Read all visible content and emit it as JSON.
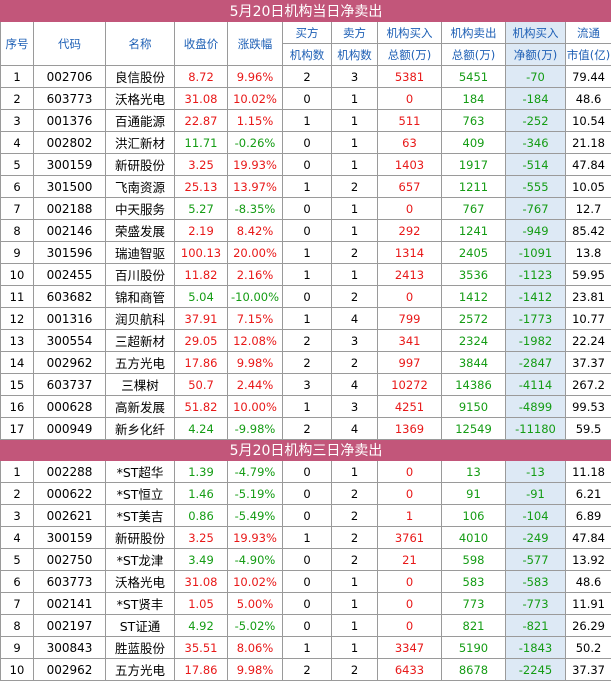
{
  "section1": {
    "title": "5月20日机构当日净卖出",
    "headers": {
      "seq": "序号",
      "code": "代码",
      "name": "名称",
      "close": "收盘价",
      "change": "涨跌幅",
      "buy_top": "买方",
      "buy_bottom": "机构数",
      "sell_top": "卖方",
      "sell_bottom": "机构数",
      "inbuy_top": "机构买入",
      "inbuy_bottom": "总额(万)",
      "insell_top": "机构卖出",
      "insell_bottom": "总额(万)",
      "net_top": "机构买入",
      "net_bottom": "净额(万)",
      "cap_top": "流通",
      "cap_bottom": "市值(亿)"
    },
    "rows": [
      [
        "1",
        "002706",
        "良信股份",
        "8.72",
        "9.96%",
        "2",
        "3",
        "5381",
        "5451",
        "-70",
        "79.44"
      ],
      [
        "2",
        "603773",
        "沃格光电",
        "31.08",
        "10.02%",
        "0",
        "1",
        "0",
        "184",
        "-184",
        "48.6"
      ],
      [
        "3",
        "001376",
        "百通能源",
        "22.87",
        "1.15%",
        "1",
        "1",
        "511",
        "763",
        "-252",
        "10.54"
      ],
      [
        "4",
        "002802",
        "洪汇新材",
        "11.71",
        "-0.26%",
        "0",
        "1",
        "63",
        "409",
        "-346",
        "21.18"
      ],
      [
        "5",
        "300159",
        "新研股份",
        "3.25",
        "19.93%",
        "0",
        "1",
        "1403",
        "1917",
        "-514",
        "47.84"
      ],
      [
        "6",
        "301500",
        "飞南资源",
        "25.13",
        "13.97%",
        "1",
        "2",
        "657",
        "1211",
        "-555",
        "10.05"
      ],
      [
        "7",
        "002188",
        "中天服务",
        "5.27",
        "-8.35%",
        "0",
        "1",
        "0",
        "767",
        "-767",
        "12.7"
      ],
      [
        "8",
        "002146",
        "荣盛发展",
        "2.19",
        "8.42%",
        "0",
        "1",
        "292",
        "1241",
        "-949",
        "85.42"
      ],
      [
        "9",
        "301596",
        "瑞迪智驱",
        "100.13",
        "20.00%",
        "1",
        "2",
        "1314",
        "2405",
        "-1091",
        "13.8"
      ],
      [
        "10",
        "002455",
        "百川股份",
        "11.82",
        "2.16%",
        "1",
        "1",
        "2413",
        "3536",
        "-1123",
        "59.95"
      ],
      [
        "11",
        "603682",
        "锦和商管",
        "5.04",
        "-10.00%",
        "0",
        "2",
        "0",
        "1412",
        "-1412",
        "23.81"
      ],
      [
        "12",
        "001316",
        "润贝航科",
        "37.91",
        "7.15%",
        "1",
        "4",
        "799",
        "2572",
        "-1773",
        "10.77"
      ],
      [
        "13",
        "300554",
        "三超新材",
        "29.05",
        "12.08%",
        "2",
        "3",
        "341",
        "2324",
        "-1982",
        "22.24"
      ],
      [
        "14",
        "002962",
        "五方光电",
        "17.86",
        "9.98%",
        "2",
        "2",
        "997",
        "3844",
        "-2847",
        "37.37"
      ],
      [
        "15",
        "603737",
        "三棵树",
        "50.7",
        "2.44%",
        "3",
        "4",
        "10272",
        "14386",
        "-4114",
        "267.2"
      ],
      [
        "16",
        "000628",
        "高新发展",
        "51.82",
        "10.00%",
        "1",
        "3",
        "4251",
        "9150",
        "-4899",
        "99.53"
      ],
      [
        "17",
        "000949",
        "新乡化纤",
        "4.24",
        "-9.98%",
        "2",
        "4",
        "1369",
        "12549",
        "-11180",
        "59.5"
      ]
    ]
  },
  "section2": {
    "title": "5月20日机构三日净卖出",
    "rows": [
      [
        "1",
        "002288",
        "*ST超华",
        "1.39",
        "-4.79%",
        "0",
        "1",
        "0",
        "13",
        "-13",
        "11.18"
      ],
      [
        "2",
        "000622",
        "*ST恒立",
        "1.46",
        "-5.19%",
        "0",
        "2",
        "0",
        "91",
        "-91",
        "6.21"
      ],
      [
        "3",
        "002621",
        "*ST美吉",
        "0.86",
        "-5.49%",
        "0",
        "2",
        "1",
        "106",
        "-104",
        "6.89"
      ],
      [
        "4",
        "300159",
        "新研股份",
        "3.25",
        "19.93%",
        "1",
        "2",
        "3761",
        "4010",
        "-249",
        "47.84"
      ],
      [
        "5",
        "002750",
        "*ST龙津",
        "3.49",
        "-4.90%",
        "0",
        "2",
        "21",
        "598",
        "-577",
        "13.92"
      ],
      [
        "6",
        "603773",
        "沃格光电",
        "31.08",
        "10.02%",
        "0",
        "1",
        "0",
        "583",
        "-583",
        "48.6"
      ],
      [
        "7",
        "002141",
        "*ST贤丰",
        "1.05",
        "5.00%",
        "0",
        "1",
        "0",
        "773",
        "-773",
        "11.91"
      ],
      [
        "8",
        "002197",
        "ST证通",
        "4.92",
        "-5.02%",
        "0",
        "1",
        "0",
        "821",
        "-821",
        "26.29"
      ],
      [
        "9",
        "300843",
        "胜蓝股份",
        "35.51",
        "8.06%",
        "1",
        "1",
        "3347",
        "5190",
        "-1843",
        "50.2"
      ],
      [
        "10",
        "002962",
        "五方光电",
        "17.86",
        "9.98%",
        "2",
        "2",
        "6433",
        "8678",
        "-2245",
        "37.37"
      ]
    ]
  }
}
